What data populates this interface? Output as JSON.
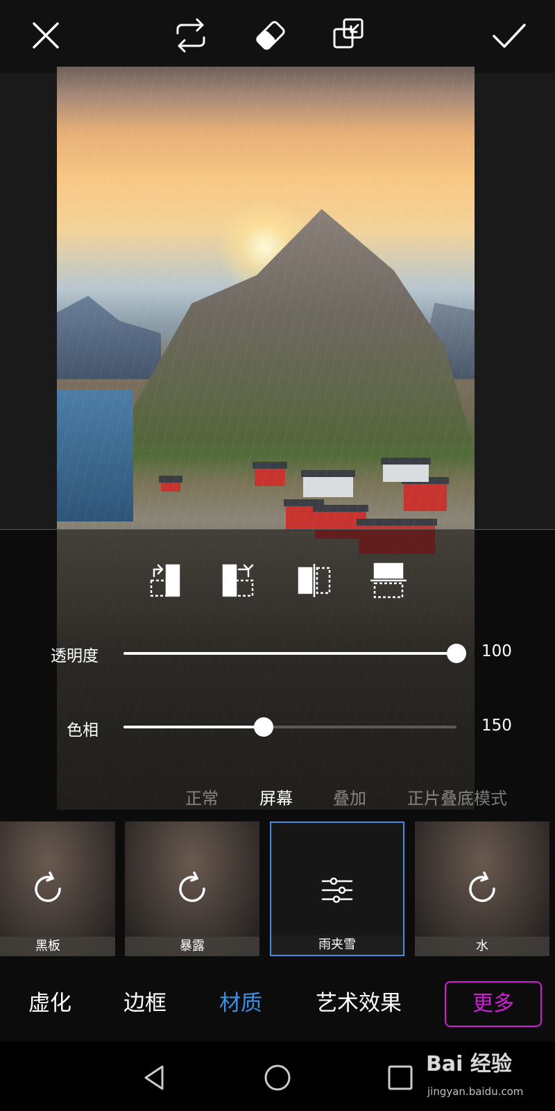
{
  "toolbar": {
    "close_icon": "close-icon",
    "swap_icon": "swap-icon",
    "eraser_icon": "eraser-icon",
    "layers_icon": "layers-icon",
    "confirm_icon": "check-icon"
  },
  "orientation_tools": [
    "rotate-left-icon",
    "rotate-right-icon",
    "flip-horizontal-icon",
    "flip-vertical-icon"
  ],
  "sliders": {
    "opacity": {
      "label": "透明度",
      "value": "100",
      "fraction": 1.0
    },
    "hue": {
      "label": "色相",
      "value": "150",
      "fraction": 0.42
    }
  },
  "blend_modes": {
    "items": [
      "正常",
      "屏幕",
      "叠加",
      "正片叠底模式"
    ],
    "active": "屏幕"
  },
  "effects": {
    "items": [
      {
        "label": "黑板",
        "icon": "refresh-icon"
      },
      {
        "label": "暴露",
        "icon": "refresh-icon"
      },
      {
        "label": "雨夹雪",
        "icon": "sliders-icon",
        "selected": true
      },
      {
        "label": "水",
        "icon": "refresh-icon"
      }
    ]
  },
  "categories": {
    "items": [
      "虚化",
      "边框",
      "材质",
      "艺术效果"
    ],
    "active": "材质",
    "more_label": "更多"
  },
  "navbar": {
    "back_icon": "back-triangle-icon",
    "home_icon": "home-circle-icon",
    "recent_icon": "recent-square-icon"
  },
  "watermark": {
    "brand": "Bai 经验",
    "url": "jingyan.baidu.com"
  },
  "colors": {
    "accent_blue": "#3b8fe6",
    "more_magenta": "#d21ed8",
    "background": "#0c0c0c"
  }
}
